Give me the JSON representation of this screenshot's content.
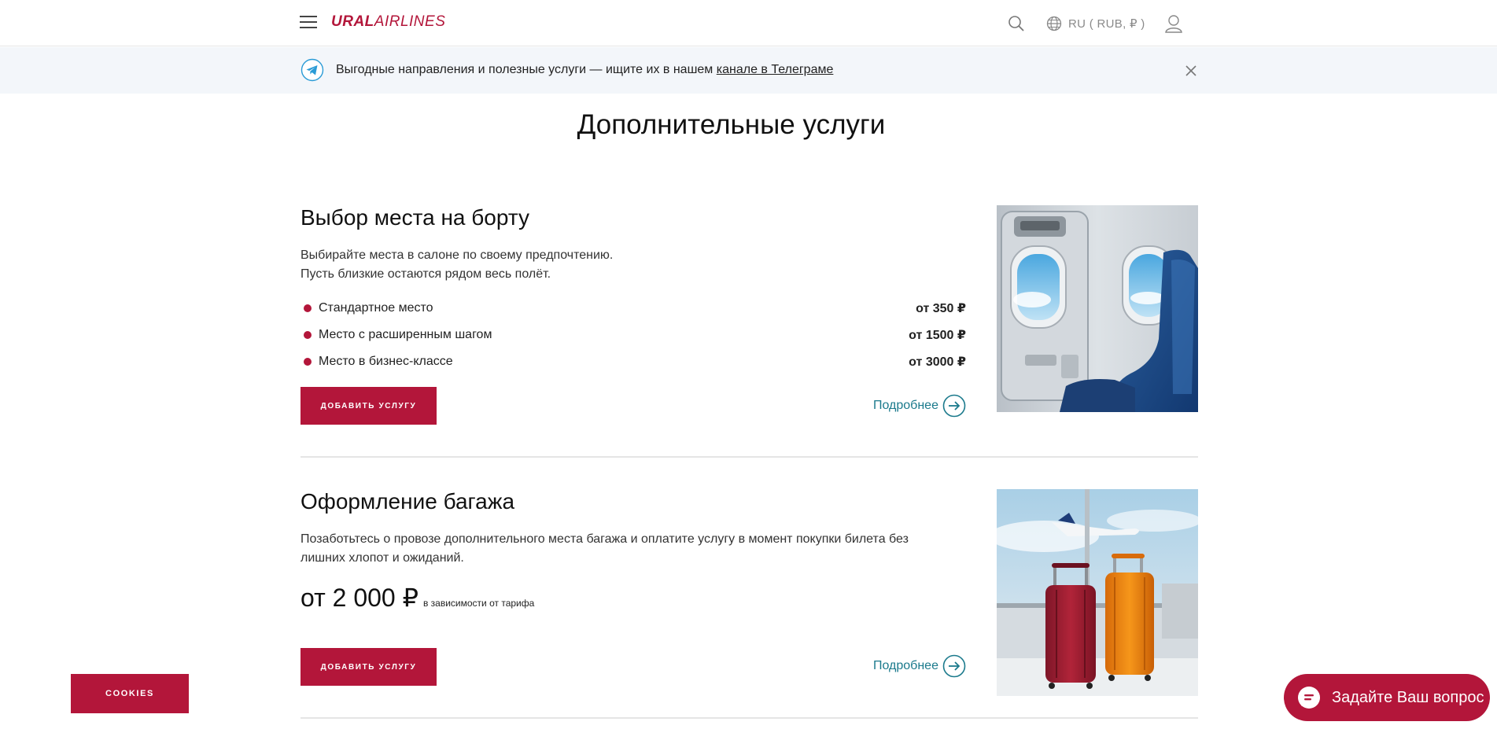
{
  "header": {
    "logo_bold": "URAL",
    "logo_light": "AIRLINES",
    "menu_icon": "hamburger-icon",
    "search_icon": "search-icon",
    "lang_icon": "globe-icon",
    "lang_label": "RU ( RUB, ₽ )",
    "user_icon": "user-icon"
  },
  "banner": {
    "icon": "telegram-icon",
    "text": "Выгодные направления и полезные услуги — ищите их в нашем ",
    "link_text": "канале в Телеграме",
    "close_icon": "close-icon"
  },
  "page_title": "Дополнительные услуги",
  "sections": [
    {
      "title": "Выбор места на борту",
      "description_line1": "Выбирайте места в салоне по своему предпочтению.",
      "description_line2": "Пусть близкие остаются рядом весь полёт.",
      "items": [
        {
          "name": "Стандартное место",
          "price": "от 350 ₽"
        },
        {
          "name": "Место с расширенным шагом",
          "price": "от 1500 ₽"
        },
        {
          "name": "Место в бизнес-классе",
          "price": "от 3000 ₽"
        }
      ],
      "button_label": "ДОБАВИТЬ УСЛУГУ",
      "more_label": "Подробнее",
      "image": "aircraft-cabin-window-seat"
    },
    {
      "title": "Оформление багажа",
      "description_line1": "Позаботьтесь о провозе дополнительного места багажа и оплатите услугу в момент покупки билета без",
      "description_line2": "лишних хлопот и ожиданий.",
      "price": "от 2 000 ₽",
      "price_note": "в зависимости от тарифа",
      "button_label": "ДОБАВИТЬ УСЛУГУ",
      "more_label": "Подробнее",
      "image": "suitcases-airport"
    }
  ],
  "cookies_label": "COOKIES",
  "chat": {
    "icon": "chat-icon",
    "label": "Задайте Ваш вопрос"
  },
  "colors": {
    "brand": "#b3163a",
    "link": "#1b7a8c",
    "banner_bg": "#f3f6fa"
  }
}
